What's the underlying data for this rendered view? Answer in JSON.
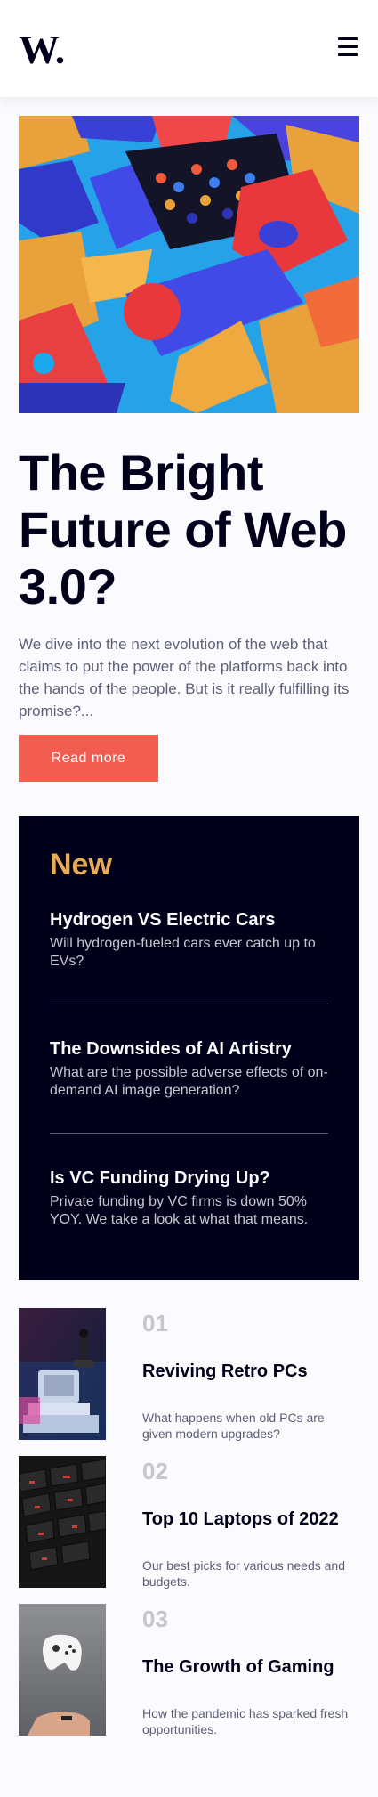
{
  "header": {
    "logo": "W.",
    "menu_icon": "hamburger-menu-icon"
  },
  "hero": {
    "image_icon": "abstract-3d-blocks-image",
    "title": "The Bright Future of Web 3.0?",
    "summary": "We dive into the next evolution of the web that claims to put the power of the platforms back into the hands of the people. But is it really fulfilling its promise?...",
    "button_label": "Read more"
  },
  "new_section": {
    "heading": "New",
    "items": [
      {
        "title": "Hydrogen VS Electric Cars",
        "desc": "Will hydrogen-fueled cars ever catch up to EVs?"
      },
      {
        "title": "The Downsides of AI Artistry",
        "desc": "What are the possible adverse effects of on-demand AI image generation?"
      },
      {
        "title": "Is VC Funding Drying Up?",
        "desc": "Private funding by VC firms is down 50% YOY. We take a look at what that means."
      }
    ]
  },
  "articles": [
    {
      "num": "01",
      "title": "Reviving Retro PCs",
      "desc": "What happens when old PCs are given modern upgrades?",
      "image": "retro-pc-image"
    },
    {
      "num": "02",
      "title": "Top 10 Laptops of 2022",
      "desc": "Our best picks for various needs and budgets.",
      "image": "laptop-keyboard-image"
    },
    {
      "num": "03",
      "title": "The Growth of Gaming",
      "desc": "How the pandemic has sparked fresh opportunities.",
      "image": "game-controller-image"
    }
  ],
  "colors": {
    "background": "#fbfbfd",
    "dark": "#00001a",
    "accent_red": "#f15d51",
    "accent_orange": "#e9ab53",
    "grey_text": "#5d5f79",
    "light_grey": "#c5c6ce"
  }
}
